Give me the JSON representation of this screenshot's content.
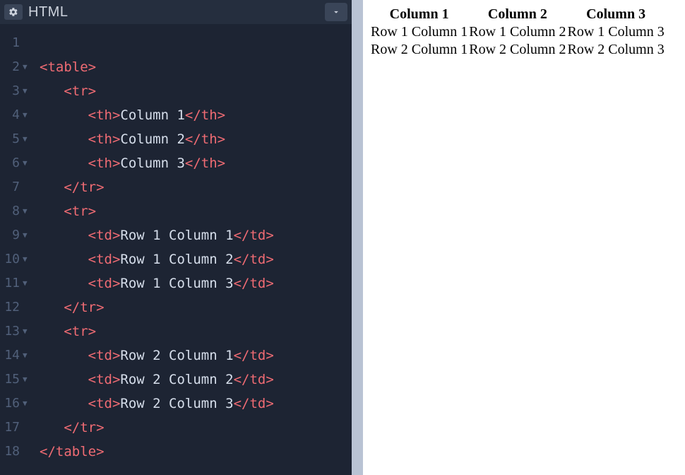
{
  "editor": {
    "language_label": "HTML",
    "lines": [
      {
        "num": "1",
        "foldable": false,
        "tokens": []
      },
      {
        "num": "2",
        "foldable": true,
        "tokens": [
          {
            "t": "tag",
            "v": "<table>"
          }
        ]
      },
      {
        "num": "3",
        "foldable": true,
        "tokens": [
          {
            "t": "txt",
            "v": "   "
          },
          {
            "t": "tag",
            "v": "<tr>"
          }
        ]
      },
      {
        "num": "4",
        "foldable": true,
        "tokens": [
          {
            "t": "txt",
            "v": "      "
          },
          {
            "t": "tag",
            "v": "<th>"
          },
          {
            "t": "txt",
            "v": "Column 1"
          },
          {
            "t": "tag",
            "v": "</th>"
          }
        ]
      },
      {
        "num": "5",
        "foldable": true,
        "tokens": [
          {
            "t": "txt",
            "v": "      "
          },
          {
            "t": "tag",
            "v": "<th>"
          },
          {
            "t": "txt",
            "v": "Column 2"
          },
          {
            "t": "tag",
            "v": "</th>"
          }
        ]
      },
      {
        "num": "6",
        "foldable": true,
        "tokens": [
          {
            "t": "txt",
            "v": "      "
          },
          {
            "t": "tag",
            "v": "<th>"
          },
          {
            "t": "txt",
            "v": "Column 3"
          },
          {
            "t": "tag",
            "v": "</th>"
          }
        ]
      },
      {
        "num": "7",
        "foldable": false,
        "tokens": [
          {
            "t": "txt",
            "v": "   "
          },
          {
            "t": "tag",
            "v": "</tr>"
          }
        ]
      },
      {
        "num": "8",
        "foldable": true,
        "tokens": [
          {
            "t": "txt",
            "v": "   "
          },
          {
            "t": "tag",
            "v": "<tr>"
          }
        ]
      },
      {
        "num": "9",
        "foldable": true,
        "tokens": [
          {
            "t": "txt",
            "v": "      "
          },
          {
            "t": "tag",
            "v": "<td>"
          },
          {
            "t": "txt",
            "v": "Row 1 Column 1"
          },
          {
            "t": "tag",
            "v": "</td>"
          }
        ]
      },
      {
        "num": "10",
        "foldable": true,
        "tokens": [
          {
            "t": "txt",
            "v": "      "
          },
          {
            "t": "tag",
            "v": "<td>"
          },
          {
            "t": "txt",
            "v": "Row 1 Column 2"
          },
          {
            "t": "tag",
            "v": "</td>"
          }
        ]
      },
      {
        "num": "11",
        "foldable": true,
        "tokens": [
          {
            "t": "txt",
            "v": "      "
          },
          {
            "t": "tag",
            "v": "<td>"
          },
          {
            "t": "txt",
            "v": "Row 1 Column 3"
          },
          {
            "t": "tag",
            "v": "</td>"
          }
        ]
      },
      {
        "num": "12",
        "foldable": false,
        "tokens": [
          {
            "t": "txt",
            "v": "   "
          },
          {
            "t": "tag",
            "v": "</tr>"
          }
        ]
      },
      {
        "num": "13",
        "foldable": true,
        "tokens": [
          {
            "t": "txt",
            "v": "   "
          },
          {
            "t": "tag",
            "v": "<tr>"
          }
        ]
      },
      {
        "num": "14",
        "foldable": true,
        "tokens": [
          {
            "t": "txt",
            "v": "      "
          },
          {
            "t": "tag",
            "v": "<td>"
          },
          {
            "t": "txt",
            "v": "Row 2 Column 1"
          },
          {
            "t": "tag",
            "v": "</td>"
          }
        ]
      },
      {
        "num": "15",
        "foldable": true,
        "tokens": [
          {
            "t": "txt",
            "v": "      "
          },
          {
            "t": "tag",
            "v": "<td>"
          },
          {
            "t": "txt",
            "v": "Row 2 Column 2"
          },
          {
            "t": "tag",
            "v": "</td>"
          }
        ]
      },
      {
        "num": "16",
        "foldable": true,
        "tokens": [
          {
            "t": "txt",
            "v": "      "
          },
          {
            "t": "tag",
            "v": "<td>"
          },
          {
            "t": "txt",
            "v": "Row 2 Column 3"
          },
          {
            "t": "tag",
            "v": "</td>"
          }
        ]
      },
      {
        "num": "17",
        "foldable": false,
        "tokens": [
          {
            "t": "txt",
            "v": "   "
          },
          {
            "t": "tag",
            "v": "</tr>"
          }
        ]
      },
      {
        "num": "18",
        "foldable": false,
        "tokens": [
          {
            "t": "tag",
            "v": "</table>"
          }
        ]
      }
    ]
  },
  "preview": {
    "headers": [
      "Column 1",
      "Column 2",
      "Column 3"
    ],
    "rows": [
      [
        "Row 1 Column 1",
        "Row 1 Column 2",
        "Row 1 Column 3"
      ],
      [
        "Row 2 Column 1",
        "Row 2 Column 2",
        "Row 2 Column 3"
      ]
    ]
  }
}
